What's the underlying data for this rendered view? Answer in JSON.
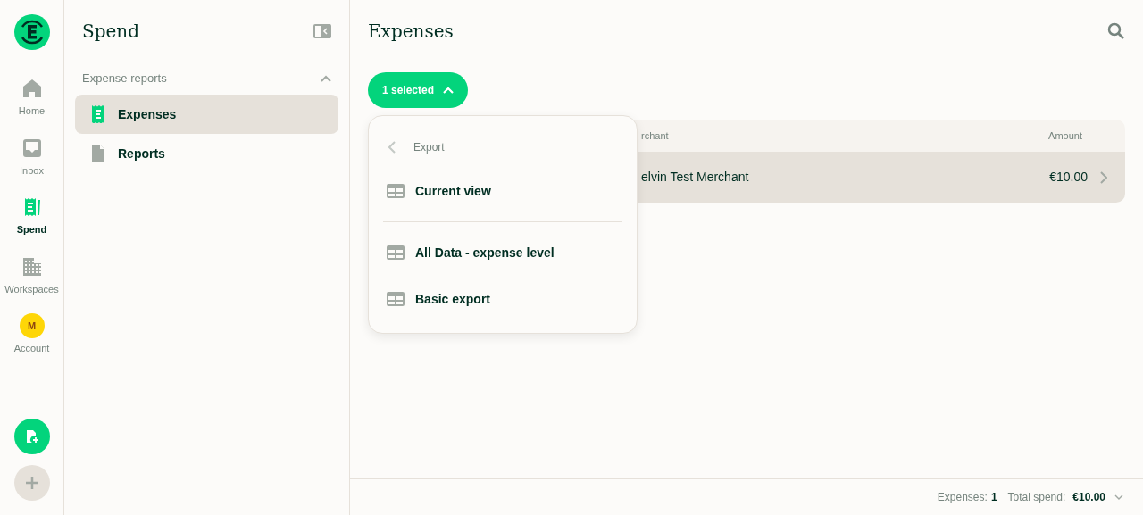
{
  "rail": {
    "items": [
      {
        "kind": "nav",
        "label": "Home",
        "selected": false
      },
      {
        "kind": "nav",
        "label": "Inbox",
        "selected": false
      },
      {
        "kind": "nav",
        "label": "Spend",
        "selected": true
      },
      {
        "kind": "nav",
        "label": "Workspaces",
        "selected": false
      },
      {
        "kind": "avatar",
        "initial": "M",
        "label": "Account",
        "selected": false
      }
    ]
  },
  "sidebar": {
    "title": "Spend",
    "section": {
      "label": "Expense reports",
      "expanded": true
    },
    "items": [
      {
        "label": "Expenses",
        "selected": true
      },
      {
        "label": "Reports",
        "selected": false
      }
    ]
  },
  "main": {
    "title": "Expenses",
    "selection_button": "1 selected",
    "export_menu": {
      "back_label": "Export",
      "groups": [
        [
          "Current view"
        ],
        [
          "All Data - expense level",
          "Basic export"
        ]
      ]
    },
    "table": {
      "columns": [
        "rchant",
        "Amount"
      ],
      "rows": [
        {
          "merchant": "elvin Test Merchant",
          "amount": "€10.00"
        }
      ]
    }
  },
  "footer": {
    "expenses_label": "Expenses:",
    "expenses_count": "1",
    "total_label": "Total spend:",
    "total": "€10.00"
  }
}
